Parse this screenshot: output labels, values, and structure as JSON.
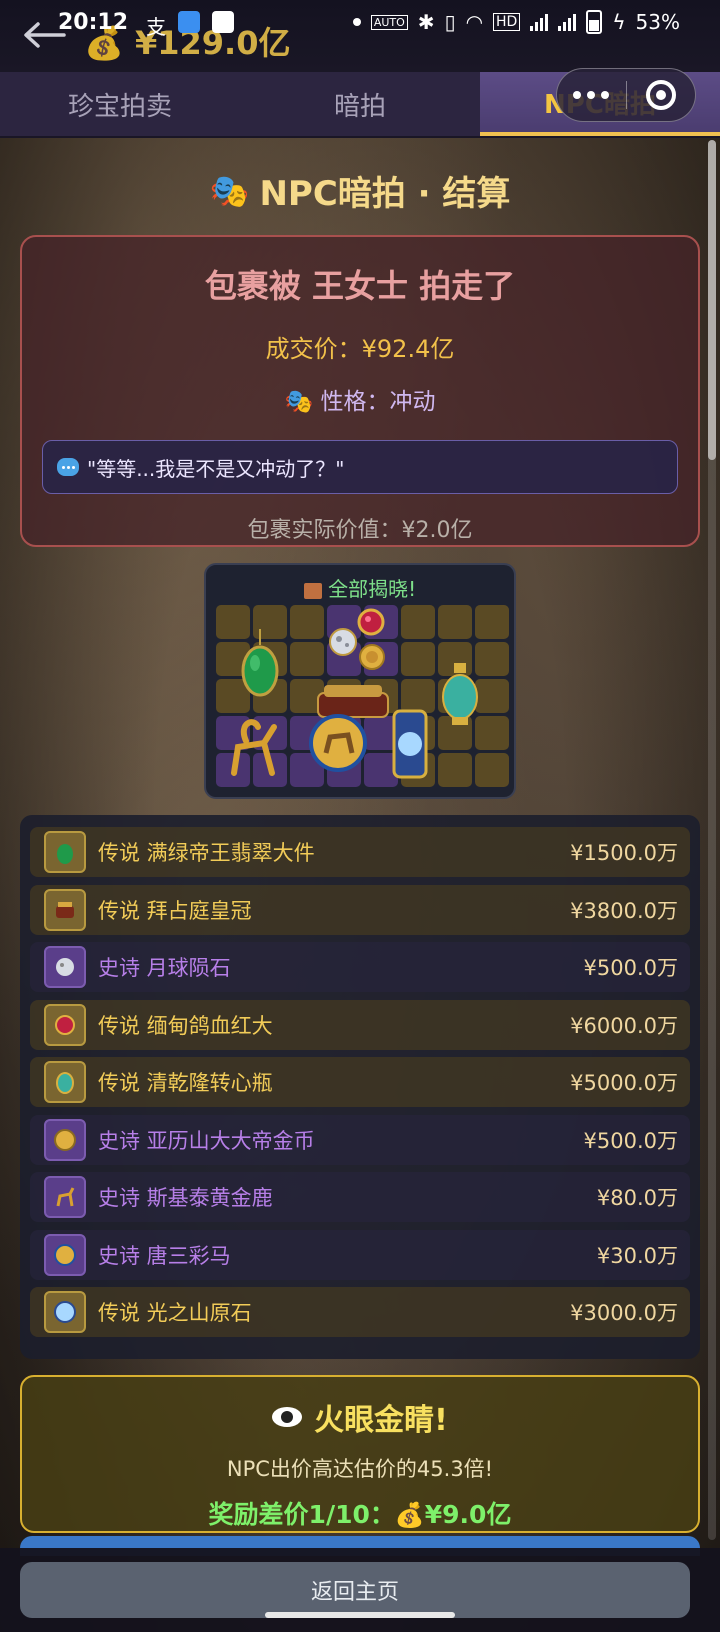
{
  "status_bar": {
    "time": "20:12",
    "battery": "53%"
  },
  "header": {
    "money": "💰 ¥129.0亿"
  },
  "tabs": [
    {
      "label": "珍宝拍卖",
      "active": false
    },
    {
      "label": "暗拍",
      "active": false
    },
    {
      "label": "NPC暗拍",
      "active": true
    }
  ],
  "section_title": "NPC暗拍 · 结算",
  "result": {
    "headline": "包裹被 王女士 拍走了",
    "deal_price": "成交价：¥92.4亿",
    "personality": "性格：冲动",
    "quote": "\"等等...我是不是又冲动了？\"",
    "actual_value": "包裹实际价值：¥2.0亿"
  },
  "grid": {
    "title": "全部揭晓!"
  },
  "items": [
    {
      "name": "传说 满绿帝王翡翠大件",
      "value": "¥1500.0万",
      "rarity": "legend",
      "icon": "jade-icon"
    },
    {
      "name": "传说 拜占庭皇冠",
      "value": "¥3800.0万",
      "rarity": "legend",
      "icon": "crown-icon"
    },
    {
      "name": "史诗 月球陨石",
      "value": "¥500.0万",
      "rarity": "epic",
      "icon": "meteorite-icon"
    },
    {
      "name": "传说 缅甸鸽血红大",
      "value": "¥6000.0万",
      "rarity": "legend",
      "icon": "ruby-icon"
    },
    {
      "name": "传说 清乾隆转心瓶",
      "value": "¥5000.0万",
      "rarity": "legend",
      "icon": "vase-icon"
    },
    {
      "name": "史诗 亚历山大大帝金币",
      "value": "¥500.0万",
      "rarity": "epic",
      "icon": "gold-coin-icon"
    },
    {
      "name": "史诗 斯基泰黄金鹿",
      "value": "¥80.0万",
      "rarity": "epic",
      "icon": "golden-deer-icon"
    },
    {
      "name": "史诗 唐三彩马",
      "value": "¥30.0万",
      "rarity": "epic",
      "icon": "tang-horse-icon"
    },
    {
      "name": "传说 光之山原石",
      "value": "¥3000.0万",
      "rarity": "legend",
      "icon": "diamond-icon"
    }
  ],
  "reward": {
    "title": "火眼金睛!",
    "desc": "NPC出价高达估价的45.3倍!",
    "amount_label": "奖励差价1/10：",
    "amount_value": "¥9.0亿"
  },
  "footer": {
    "home_label": "返回主页"
  },
  "colors": {
    "legend": "#f2cc58",
    "epic": "#b77fe8",
    "accent": "#f4c542",
    "reward_green": "#7ef06a"
  }
}
